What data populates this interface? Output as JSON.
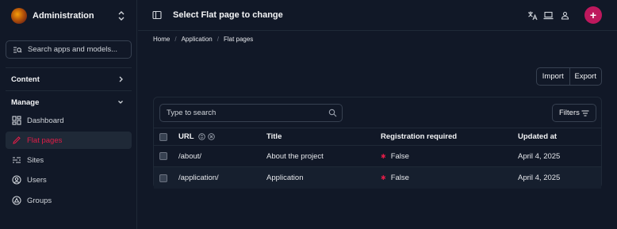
{
  "app": {
    "name": "Administration"
  },
  "sidebar": {
    "search_placeholder": "Search apps and models...",
    "sections": [
      {
        "label": "Content"
      },
      {
        "label": "Manage"
      }
    ],
    "items": [
      {
        "label": "Dashboard",
        "icon": "dashboard-icon"
      },
      {
        "label": "Flat pages",
        "icon": "pencil-icon",
        "active": true
      },
      {
        "label": "Sites",
        "icon": "sites-icon"
      },
      {
        "label": "Users",
        "icon": "user-circle-icon"
      },
      {
        "label": "Groups",
        "icon": "groups-icon"
      }
    ]
  },
  "header": {
    "title": "Select Flat page to change",
    "add_label": "+"
  },
  "breadcrumb": [
    "Home",
    "Application",
    "Flat pages"
  ],
  "actions": {
    "import_label": "Import",
    "export_label": "Export"
  },
  "table": {
    "search_placeholder": "Type to search",
    "filters_label": "Filters",
    "columns": [
      "URL",
      "Title",
      "Registration required",
      "Updated at"
    ],
    "rows": [
      {
        "url": "/about/",
        "title": "About the project",
        "registration": "False",
        "updated": "April 4, 2025"
      },
      {
        "url": "/application/",
        "title": "Application",
        "registration": "False",
        "updated": "April 4, 2025"
      }
    ]
  },
  "colors": {
    "background": "#111827",
    "accent": "#e11d48",
    "add_button": "#be185d"
  }
}
